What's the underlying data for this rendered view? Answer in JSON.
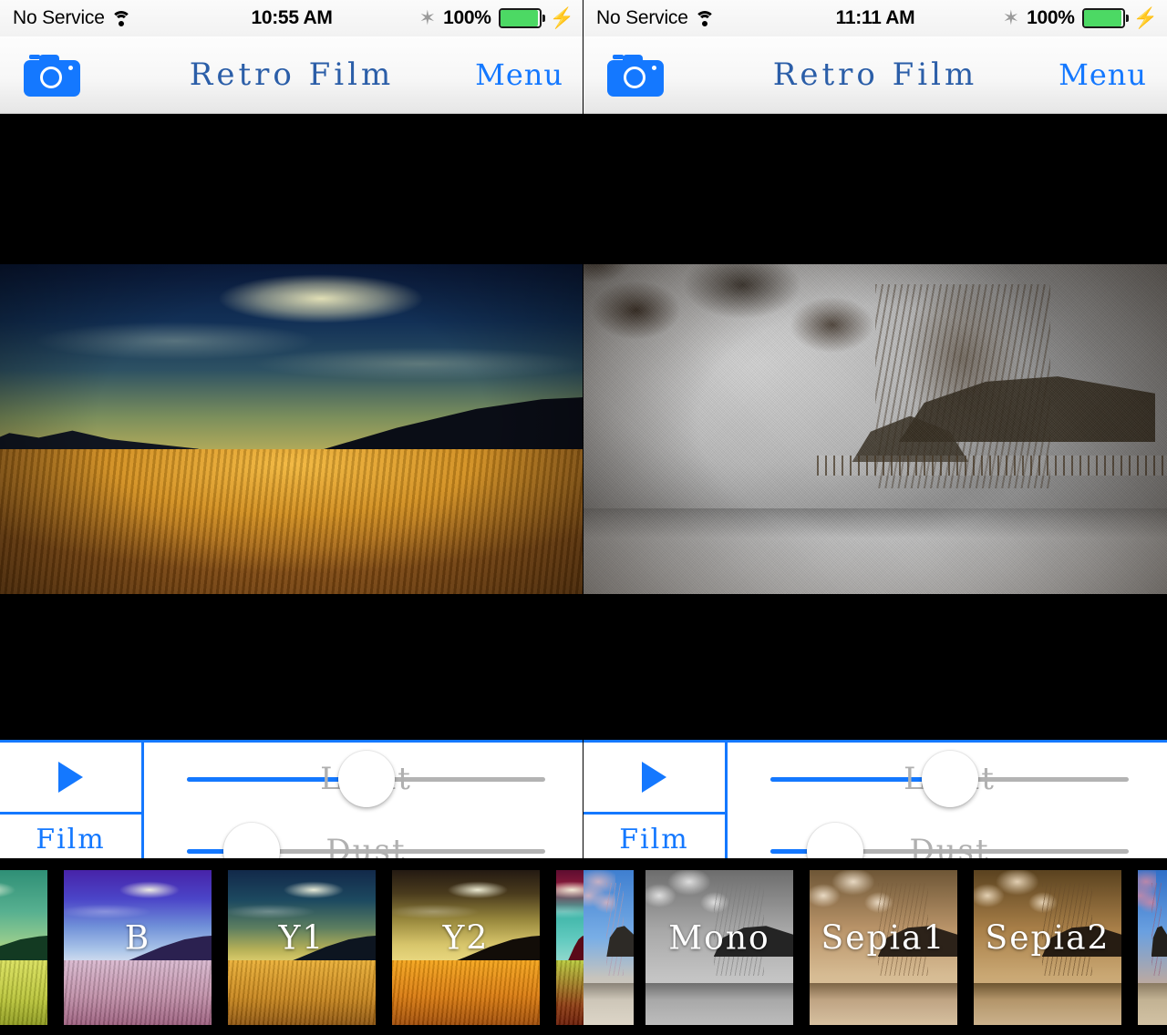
{
  "app": {
    "title": "Retro Film",
    "menu_label": "Menu",
    "camera_icon": "camera-icon",
    "accent_color": "#1478ff",
    "title_color": "#2b5ea8"
  },
  "panels": [
    {
      "id": "left",
      "status": {
        "carrier": "No Service",
        "wifi_icon": "wifi-icon",
        "time": "10:55 AM",
        "bluetooth_icon": "bluetooth-icon",
        "battery_percent": "100%",
        "battery_icon": "battery-full-icon",
        "charging_icon": "lightning-bolt-icon"
      },
      "preview": "landscape-golden-field",
      "controls": {
        "play_label": "play-icon",
        "tab_label": "Film",
        "sliders": [
          {
            "label": "Light",
            "value": 50
          },
          {
            "label": "Dust",
            "value": 18
          }
        ]
      }
    },
    {
      "id": "right",
      "status": {
        "carrier": "No Service",
        "wifi_icon": "wifi-icon",
        "time": "11:11 AM",
        "bluetooth_icon": "bluetooth-icon",
        "battery_percent": "100%",
        "battery_icon": "battery-full-icon",
        "charging_icon": "lightning-bolt-icon"
      },
      "preview": "shrine-sepia-monochrome",
      "controls": {
        "play_label": "play-icon",
        "tab_label": "Film",
        "sliders": [
          {
            "label": "Light",
            "value": 50
          },
          {
            "label": "Dust",
            "value": 18
          }
        ]
      }
    }
  ],
  "filmstrip": {
    "thumbnails": [
      {
        "caption": "",
        "scene": "landscape",
        "theme": "green",
        "partial": "left"
      },
      {
        "caption": "B",
        "scene": "landscape",
        "theme": "blue",
        "partial": ""
      },
      {
        "caption": "Y1",
        "scene": "landscape",
        "theme": "yellow1",
        "partial": ""
      },
      {
        "caption": "Y2",
        "scene": "landscape",
        "theme": "yellow2",
        "partial": ""
      },
      {
        "caption": "",
        "scene": "landscape",
        "theme": "cyanred",
        "partial": "right"
      },
      {
        "caption": "",
        "scene": "shrine",
        "theme": "normal",
        "partial": "left"
      },
      {
        "caption": "Mono",
        "scene": "shrine",
        "theme": "mono",
        "partial": ""
      },
      {
        "caption": "Sepia1",
        "scene": "shrine",
        "theme": "sepia1",
        "partial": ""
      },
      {
        "caption": "Sepia2",
        "scene": "shrine",
        "theme": "sepia2",
        "partial": ""
      },
      {
        "caption": "",
        "scene": "shrine",
        "theme": "color",
        "partial": "right"
      }
    ]
  }
}
